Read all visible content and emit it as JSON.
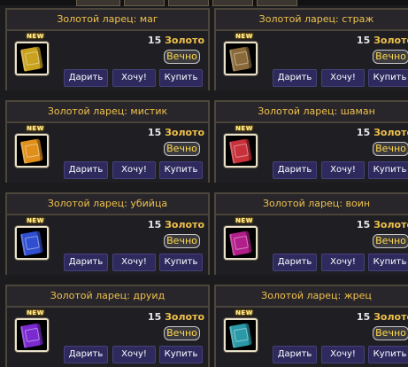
{
  "items": [
    {
      "title": "Золотой ларец: маг",
      "price": "15",
      "currency": "Золото",
      "duration": "Вечно",
      "badge": "NEW",
      "book_color": "#c9a21f"
    },
    {
      "title": "Золотой ларец: страж",
      "price": "15",
      "currency": "Золото",
      "duration": "Вечно",
      "badge": "NEW",
      "book_color": "#8a6a3a"
    },
    {
      "title": "Золотой ларец: мистик",
      "price": "15",
      "currency": "Золото",
      "duration": "Вечно",
      "badge": "NEW",
      "book_color": "#e0901a"
    },
    {
      "title": "Золотой ларец: шаман",
      "price": "15",
      "currency": "Золото",
      "duration": "Вечно",
      "badge": "NEW",
      "book_color": "#c8303a"
    },
    {
      "title": "Золотой ларец: убийца",
      "price": "15",
      "currency": "Золото",
      "duration": "Вечно",
      "badge": "NEW",
      "book_color": "#2f4fd0"
    },
    {
      "title": "Золотой ларец: воин",
      "price": "15",
      "currency": "Золото",
      "duration": "Вечно",
      "badge": "NEW",
      "book_color": "#b21e8a"
    },
    {
      "title": "Золотой ларец: друид",
      "price": "15",
      "currency": "Золото",
      "duration": "Вечно",
      "badge": "NEW",
      "book_color": "#7a2ad0"
    },
    {
      "title": "Золотой ларец: жрец",
      "price": "15",
      "currency": "Золото",
      "duration": "Вечно",
      "badge": "NEW",
      "book_color": "#2a9aa8"
    }
  ],
  "buttons": {
    "gift": "Дарить",
    "wish": "Хочу!",
    "buy": "Купить"
  },
  "icons": {
    "item": "book-icon"
  }
}
